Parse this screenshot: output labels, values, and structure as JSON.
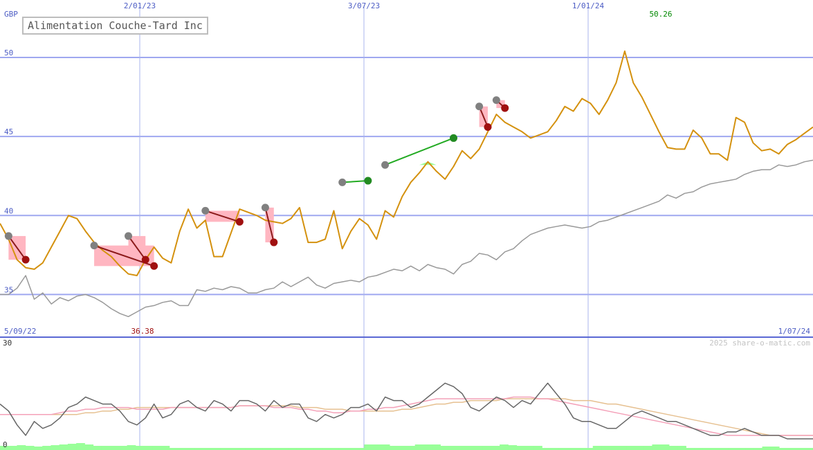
{
  "title": "Alimentation Couche-Tard Inc",
  "currency": "GBP",
  "credit": "2025 share-o-matic.com",
  "colors": {
    "price": "#d4910e",
    "index": "#999999",
    "grid_h": "#9fa8f0",
    "grid_v": "#a9b4ee",
    "axis_text": "#4c5cc4",
    "buy": "#99ff99",
    "sell": "#ffb6c1",
    "buy_line": "#22aa22",
    "sell_line": "#8b1a1a",
    "osc_line": "#666666",
    "osc_ma1": "#f4a0b8",
    "osc_ma2": "#e6c090",
    "volume": "#99ff99"
  },
  "chart_data": [
    {
      "type": "line",
      "name": "price-panel",
      "y_ticks": [
        35,
        40,
        45,
        50
      ],
      "ylim": [
        32.3,
        53.2
      ],
      "x_tick_labels": [
        "2/01/23",
        "3/07/23",
        "1/01/24"
      ],
      "start_label": "5/09/22",
      "end_label": "1/07/24",
      "high_label": "50.26",
      "low_label": "36.38",
      "n_points": 96,
      "series": [
        {
          "name": "price",
          "values": [
            39.5,
            38.5,
            37.2,
            36.7,
            36.6,
            37,
            38,
            39,
            40,
            39.8,
            39,
            38.3,
            37.8,
            37.4,
            36.8,
            36.3,
            36.2,
            37.2,
            38,
            37.3,
            37,
            39,
            40.4,
            39.2,
            39.7,
            37.4,
            37.4,
            38.9,
            40.4,
            40.2,
            40,
            39.7,
            39.6,
            39.5,
            39.8,
            40.5,
            38.3,
            38.3,
            38.5,
            40.3,
            37.9,
            39,
            39.8,
            39.4,
            38.5,
            40.3,
            39.9,
            41.2,
            42.1,
            42.7,
            43.4,
            42.8,
            42.3,
            43.1,
            44.1,
            43.6,
            44.2,
            45.3,
            46.4,
            45.9,
            45.6,
            45.3,
            44.9,
            45.1,
            45.3,
            46,
            46.9,
            46.6,
            47.4,
            47.1,
            46.4,
            47.3,
            48.4,
            50.4,
            48.4,
            47.5,
            46.4,
            45.3,
            44.3,
            44.2,
            44.2,
            45.4,
            44.9,
            43.9,
            43.9,
            43.5,
            46.2,
            45.9,
            44.6,
            44.1,
            44.2,
            43.9,
            44.5,
            44.8,
            45.2,
            45.6
          ]
        },
        {
          "name": "index",
          "values": [
            35,
            35,
            35.4,
            36.2,
            34.7,
            35.1,
            34.4,
            34.8,
            34.6,
            34.9,
            35,
            34.8,
            34.5,
            34.1,
            33.8,
            33.6,
            33.9,
            34.2,
            34.3,
            34.5,
            34.6,
            34.3,
            34.3,
            35.3,
            35.2,
            35.4,
            35.3,
            35.5,
            35.4,
            35.1,
            35.1,
            35.3,
            35.4,
            35.8,
            35.5,
            35.8,
            36.1,
            35.6,
            35.4,
            35.7,
            35.8,
            35.9,
            35.8,
            36.1,
            36.2,
            36.4,
            36.6,
            36.5,
            36.8,
            36.5,
            36.9,
            36.7,
            36.6,
            36.3,
            36.9,
            37.1,
            37.6,
            37.5,
            37.2,
            37.7,
            37.9,
            38.4,
            38.8,
            39,
            39.2,
            39.3,
            39.4,
            39.3,
            39.2,
            39.3,
            39.6,
            39.7,
            39.9,
            40.1,
            40.3,
            40.5,
            40.7,
            40.9,
            41.3,
            41.1,
            41.4,
            41.5,
            41.8,
            42,
            42.1,
            42.2,
            42.3,
            42.6,
            42.8,
            42.9,
            42.9,
            43.2,
            43.1,
            43.2,
            43.4,
            43.5
          ]
        }
      ],
      "buy_signals": [
        {
          "start_index": 11,
          "start_value": 38.1,
          "end_index": 18,
          "end_value": 36.8,
          "result": "loss"
        },
        {
          "start_index": 40,
          "start_value": 42.1,
          "end_index": 43,
          "end_value": 42.2,
          "result": "gain"
        },
        {
          "start_index": 45,
          "start_value": 43.2,
          "end_index": 53,
          "end_value": 44.9,
          "result": "gain"
        }
      ],
      "sell_signals": [
        {
          "start_index": 1,
          "start_value": 38.7,
          "end_index": 3,
          "end_value": 37.2,
          "result": "loss"
        },
        {
          "start_index": 15,
          "start_value": 38.7,
          "end_index": 17,
          "end_value": 37.2,
          "result": "loss"
        },
        {
          "start_index": 24,
          "start_value": 40.3,
          "end_index": 28,
          "end_value": 39.6,
          "result": "loss"
        },
        {
          "start_index": 31,
          "start_value": 40.5,
          "end_index": 32,
          "end_value": 38.3,
          "result": "loss"
        },
        {
          "start_index": 56,
          "start_value": 46.9,
          "end_index": 57,
          "end_value": 45.6,
          "result": "loss"
        },
        {
          "start_index": 58,
          "start_value": 47.3,
          "end_index": 59,
          "end_value": 46.8,
          "result": "loss"
        }
      ]
    },
    {
      "type": "line",
      "name": "oscillator-panel",
      "ylim": [
        0,
        30
      ],
      "y_tick_labels": [
        "30",
        "0"
      ],
      "series": [
        {
          "name": "oscillator",
          "values": [
            12,
            10,
            6,
            3,
            7,
            5,
            6,
            8,
            11,
            12,
            14,
            13,
            12,
            12,
            10,
            7,
            6,
            8,
            12,
            8,
            9,
            12,
            13,
            11,
            10,
            13,
            12,
            10,
            13,
            13,
            12,
            10,
            13,
            11,
            12,
            12,
            8,
            7,
            9,
            8,
            9,
            11,
            11,
            12,
            10,
            14,
            13,
            13,
            11,
            12,
            14,
            16,
            18,
            17,
            15,
            11,
            10,
            12,
            14,
            13,
            11,
            13,
            12,
            15,
            18,
            15,
            12,
            8,
            7,
            7,
            6,
            5,
            5,
            7,
            9,
            10,
            9,
            8,
            7,
            7,
            6,
            5,
            4,
            3,
            3,
            4,
            4,
            5,
            4,
            3,
            3,
            3,
            2,
            2,
            2,
            2
          ]
        },
        {
          "name": "average-short",
          "values": [
            9,
            9,
            9,
            9,
            9,
            9,
            9,
            9.5,
            10,
            10,
            10.5,
            10.5,
            11,
            11,
            11,
            11,
            10.5,
            10.5,
            10.5,
            10.5,
            11,
            11,
            11,
            11,
            11,
            11,
            11,
            11,
            11.5,
            11.5,
            11.5,
            11.5,
            11,
            11,
            11,
            10.5,
            10.5,
            10,
            10,
            9.5,
            9.5,
            10,
            10,
            10.5,
            10.5,
            11,
            11,
            11.5,
            12,
            12.5,
            13,
            13.5,
            13.5,
            13.5,
            13.5,
            13.5,
            13.5,
            13.5,
            13.5,
            13.5,
            14,
            14,
            14,
            13.5,
            13.5,
            13,
            12.5,
            12,
            11.5,
            11,
            10.5,
            10,
            9.5,
            9,
            8.5,
            8,
            7.5,
            7,
            6.5,
            6,
            5.5,
            5,
            4.5,
            4,
            3.5,
            3,
            3,
            3,
            3,
            3,
            3,
            3,
            3,
            3,
            3,
            3
          ]
        },
        {
          "name": "average-long",
          "values": [
            9,
            9,
            9,
            9,
            9,
            9,
            9,
            9,
            9,
            9,
            9.5,
            9.5,
            10,
            10,
            10.5,
            10.5,
            11,
            11,
            11,
            11,
            11,
            11,
            11,
            11,
            11,
            11,
            11,
            11,
            11.5,
            11.5,
            11.5,
            11.5,
            11.5,
            11.5,
            11.5,
            11,
            11,
            11,
            10.5,
            10.5,
            10.5,
            10,
            10,
            10,
            10,
            10,
            10,
            10.5,
            10.5,
            11,
            11.5,
            12,
            12,
            12.5,
            12.5,
            13,
            13,
            13,
            13,
            13.5,
            13.5,
            13.5,
            13.5,
            13.5,
            13.5,
            13.5,
            13.5,
            13,
            13,
            13,
            12.5,
            12,
            12,
            11.5,
            11,
            10.5,
            10,
            9.5,
            9,
            8.5,
            8,
            7.5,
            7,
            6.5,
            6,
            5.5,
            5,
            4.5,
            4,
            3.5,
            3,
            3,
            3,
            3,
            3,
            3
          ]
        }
      ],
      "volume": [
        0.6,
        0.6,
        0.7,
        0.6,
        0.5,
        0.6,
        0.7,
        0.8,
        0.9,
        1.0,
        0.8,
        0.6,
        0.6,
        0.6,
        0.6,
        0.7,
        0.6,
        0.6,
        0.6,
        0.6,
        0.3,
        0.3,
        0.3,
        0.3,
        0.3,
        0.3,
        0.3,
        0.3,
        0.3,
        0.3,
        0.3,
        0.3,
        0.3,
        0.3,
        0.3,
        0.3,
        0.3,
        0.3,
        0.3,
        0.3,
        0.3,
        0.3,
        0.3,
        0.8,
        0.8,
        0.8,
        0.6,
        0.6,
        0.6,
        0.8,
        0.8,
        0.8,
        0.6,
        0.6,
        0.6,
        0.6,
        0.6,
        0.6,
        0.6,
        0.8,
        0.7,
        0.6,
        0.6,
        0.6,
        0.3,
        0.3,
        0.3,
        0.3,
        0.3,
        0.3,
        0.6,
        0.6,
        0.6,
        0.6,
        0.6,
        0.6,
        0.6,
        0.8,
        0.8,
        0.6,
        0.6,
        0.3,
        0.3,
        0.3,
        0.3,
        0.3,
        0.3,
        0.3,
        0.3,
        0.3,
        0.5,
        0.5,
        0.3,
        0.3,
        0.3,
        0.3
      ]
    }
  ]
}
